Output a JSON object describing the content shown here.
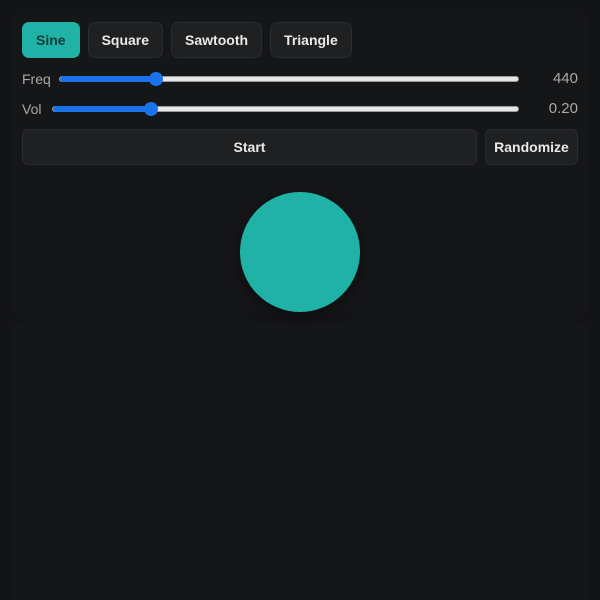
{
  "waveforms": {
    "items": [
      {
        "label": "Sine"
      },
      {
        "label": "Square"
      },
      {
        "label": "Sawtooth"
      },
      {
        "label": "Triangle"
      }
    ],
    "selected": "Sine"
  },
  "freq": {
    "label": "Freq",
    "value": "440",
    "fraction": 0.21
  },
  "vol": {
    "label": "Vol",
    "value": "0.20",
    "fraction": 0.21
  },
  "actions": {
    "start_label": "Start",
    "randomize_label": "Randomize"
  },
  "colors": {
    "accent": "#20b2a6",
    "slider": "#1a73e8",
    "background": "#131416"
  }
}
